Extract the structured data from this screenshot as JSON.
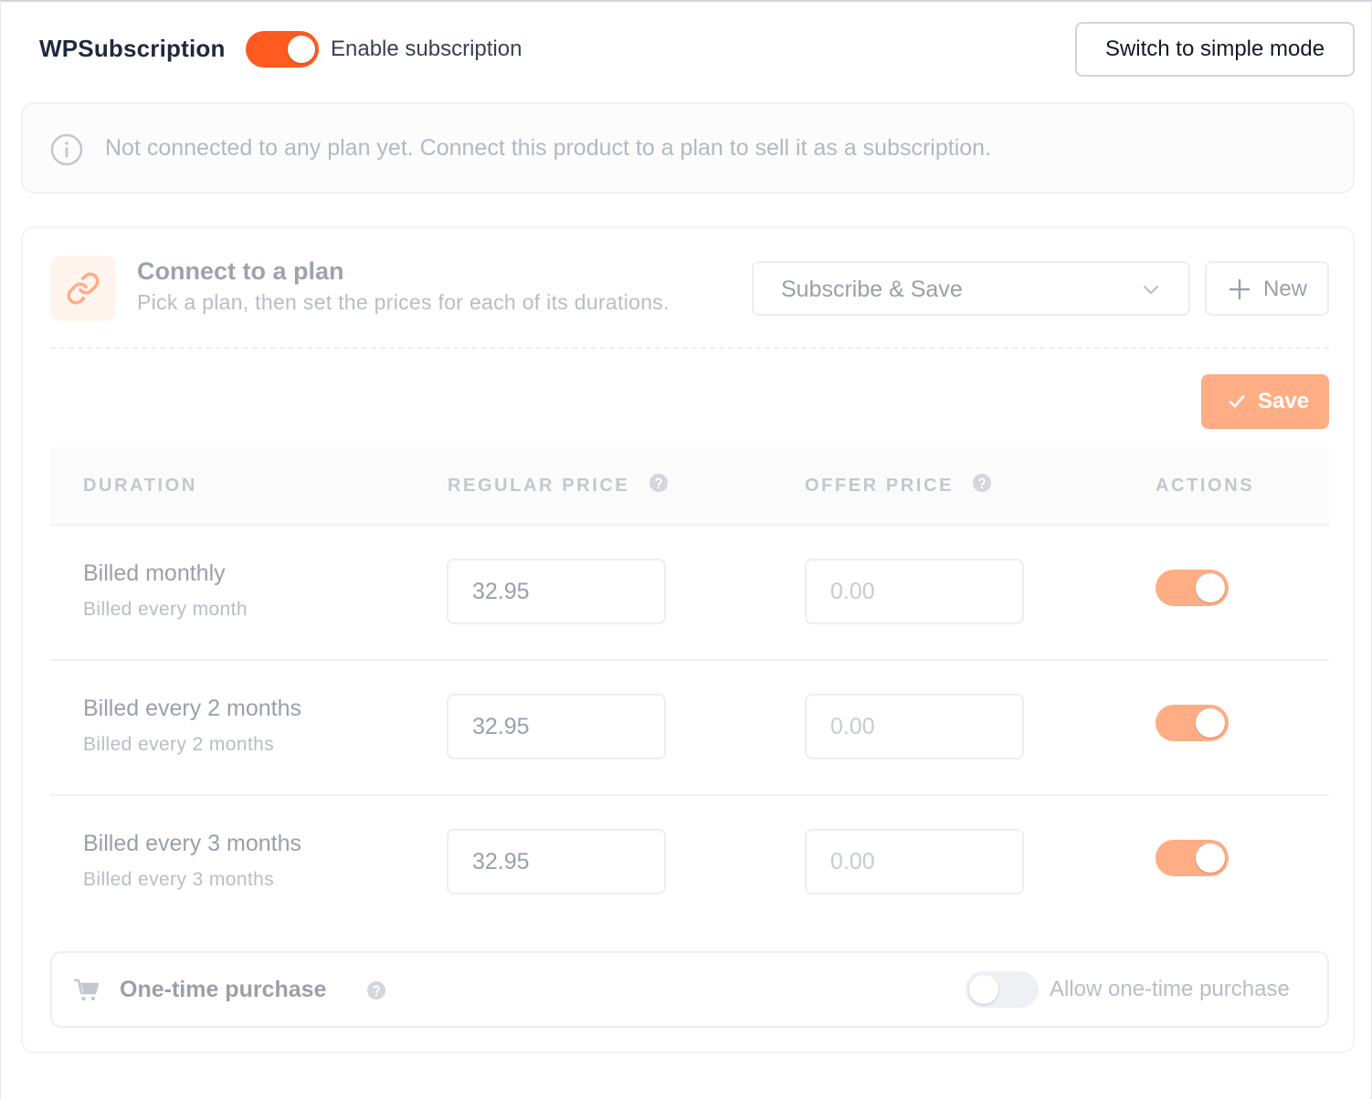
{
  "header": {
    "brand": "WPSubscription",
    "enable_label": "Enable subscription",
    "enable_on": true,
    "switch_mode_label": "Switch to simple mode"
  },
  "notice": {
    "icon": "info-icon",
    "text": "Not connected to any plan yet. Connect this product to a plan to sell it as a subscription."
  },
  "connect": {
    "icon": "link-icon",
    "title": "Connect to a plan",
    "subtitle": "Pick a plan, then set the prices for each of its durations.",
    "plan_selected": "Subscribe & Save",
    "new_label": "New",
    "save_label": "Save"
  },
  "table": {
    "headers": {
      "duration": "DURATION",
      "regular_price": "REGULAR PRICE",
      "offer_price": "OFFER PRICE",
      "actions": "ACTIONS"
    },
    "rows": [
      {
        "title": "Billed monthly",
        "subtitle": "Billed every month",
        "regular_price": "32.95",
        "offer_placeholder": "0.00",
        "enabled": true
      },
      {
        "title": "Billed every 2 months",
        "subtitle": "Billed every 2 months",
        "regular_price": "32.95",
        "offer_placeholder": "0.00",
        "enabled": true
      },
      {
        "title": "Billed every 3 months",
        "subtitle": "Billed every 3 months",
        "regular_price": "32.95",
        "offer_placeholder": "0.00",
        "enabled": true
      }
    ]
  },
  "one_time": {
    "icon": "cart-icon",
    "title": "One-time purchase",
    "allow_label": "Allow one-time purchase",
    "allow_on": false
  },
  "colors": {
    "accent": "#ff5a1f",
    "accent_muted": "#ffad85",
    "text_dark": "#1e2a3b",
    "text_muted": "#9aa0aa"
  }
}
